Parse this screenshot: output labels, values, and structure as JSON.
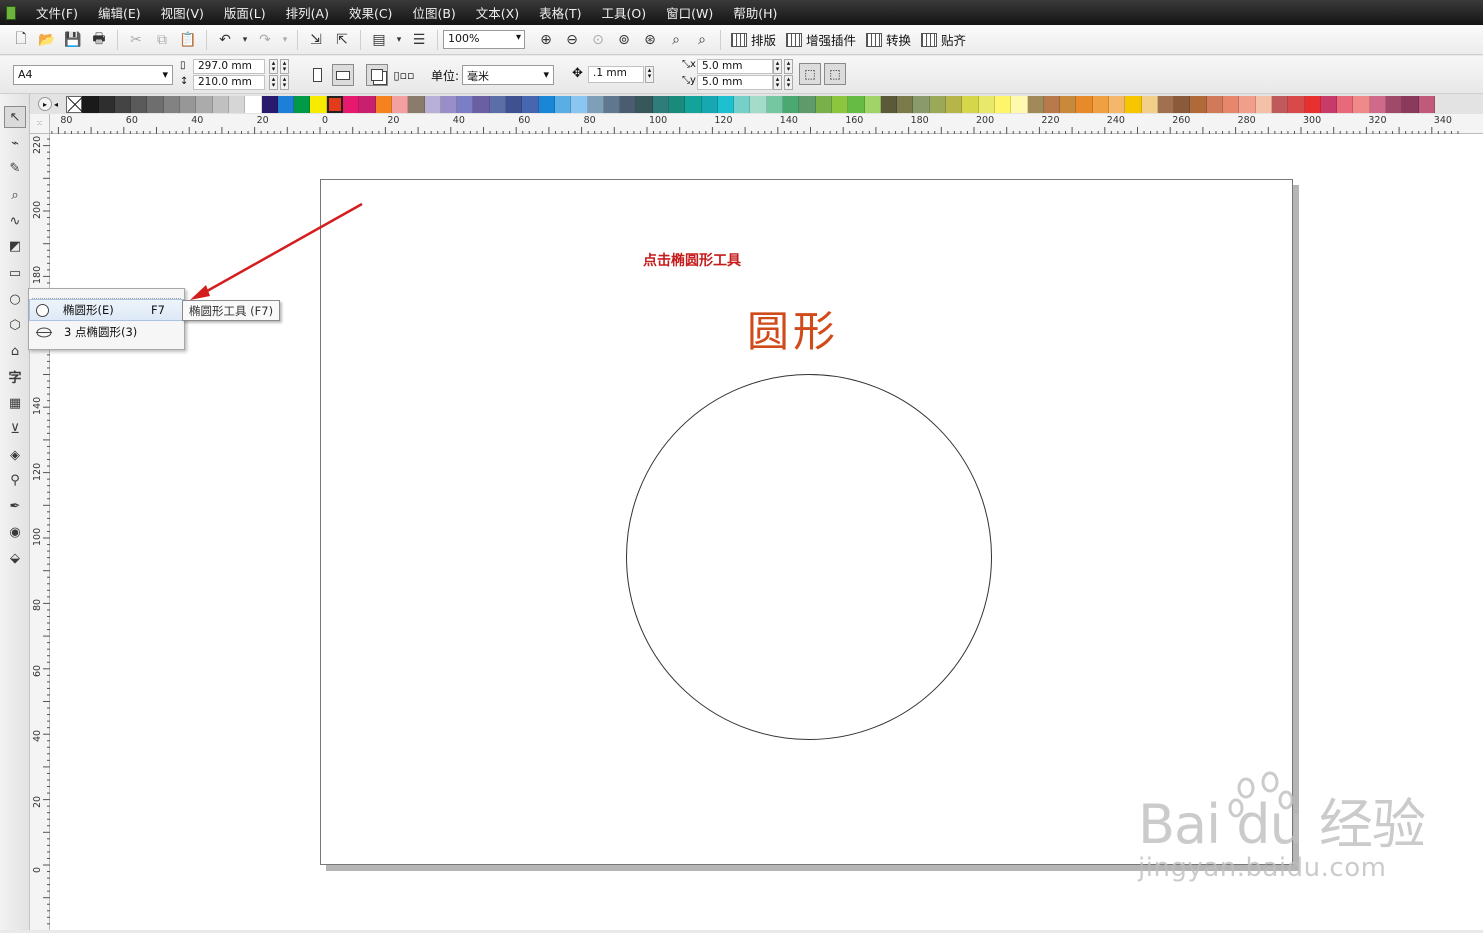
{
  "menubar": {
    "items": [
      "文件(F)",
      "编辑(E)",
      "视图(V)",
      "版面(L)",
      "排列(A)",
      "效果(C)",
      "位图(B)",
      "文本(X)",
      "表格(T)",
      "工具(O)",
      "窗口(W)",
      "帮助(H)"
    ]
  },
  "toolbar": {
    "zoom": "100%",
    "buttons": [
      "排版",
      "增强插件",
      "转换",
      "贴齐"
    ]
  },
  "property_bar": {
    "page_size": "A4",
    "width": "297.0 mm",
    "height": "210.0 mm",
    "unit_label": "单位:",
    "unit_value": "毫米",
    "nudge": ".1 mm",
    "dup_x": "5.0 mm",
    "dup_y": "5.0 mm"
  },
  "palette": {
    "colors": [
      "#1a1a1a",
      "#2e2e2e",
      "#444444",
      "#5a5a5a",
      "#6e6e6e",
      "#828282",
      "#979797",
      "#ababab",
      "#c0c0c0",
      "#d6d6d6",
      "#ffffff",
      "#2a1a6e",
      "#1e7fd6",
      "#009a46",
      "#f7ec00",
      "#e23c1c",
      "#e6196e",
      "#c81f6f",
      "#f5821f",
      "#f2a0a0",
      "#8a7b6b",
      "#b8b0d6",
      "#9a8ec9",
      "#7b7ec4",
      "#6a5fa3",
      "#5b6ea8",
      "#3f5190",
      "#4666b0",
      "#1a87d6",
      "#5aaee6",
      "#8ac6ef",
      "#7f9fb8",
      "#5f7890",
      "#4a5c70",
      "#37585a",
      "#2f7d7a",
      "#1a8a7a",
      "#14a39b",
      "#17a7b3",
      "#1ec0cf",
      "#75d1c8",
      "#a4dcc9",
      "#74c7a0",
      "#4aa870",
      "#5e9a6a",
      "#7ab04a",
      "#8cc63f",
      "#66bb44",
      "#a0d468",
      "#5a5a3a",
      "#7a7a4a",
      "#8a9a6a",
      "#9aa858",
      "#b5b54a",
      "#d6d64a",
      "#e8e86a",
      "#fff56a",
      "#fff9b0",
      "#a08a5a",
      "#b87a4a",
      "#c88a3a",
      "#e68a2a",
      "#f0a040",
      "#f5b86a",
      "#f7c600",
      "#f2d08a",
      "#a07050",
      "#8a5a3a",
      "#b06a3a",
      "#d07a5a",
      "#e6866a",
      "#f0a08a",
      "#f5c0a8",
      "#c05a5a",
      "#d84a4a",
      "#e83030",
      "#c83a6a",
      "#e86a7a",
      "#f08a8a",
      "#d06a8a",
      "#a04a6a",
      "#8a3a5a",
      "#c05a7a"
    ],
    "selected_index": 15
  },
  "rulers": {
    "h_labels": [
      "80",
      "60",
      "40",
      "20",
      "0",
      "20",
      "40",
      "60",
      "80",
      "100",
      "120",
      "140",
      "160",
      "180",
      "200",
      "220",
      "240",
      "260",
      "280",
      "300",
      "320",
      "340"
    ],
    "v_labels": [
      "220",
      "200",
      "180",
      "160",
      "140",
      "120",
      "100",
      "80",
      "60",
      "40",
      "20",
      "0"
    ],
    "unit": "毫米"
  },
  "toolbox": {
    "tools": [
      "pick",
      "shape",
      "smear",
      "zoom",
      "freehand",
      "smart-fill",
      "rectangle",
      "ellipse",
      "polygon",
      "basic-shapes",
      "text",
      "table",
      "dimension",
      "interactive-fill",
      "eyedropper",
      "outline",
      "fill",
      "interactive"
    ]
  },
  "flyout": {
    "items": [
      {
        "label": "椭圆形(E)",
        "shortcut": "F7"
      },
      {
        "label": "3 点椭圆形(3)",
        "shortcut": ""
      }
    ],
    "tooltip": "椭圆形工具 (F7)"
  },
  "document": {
    "title_text": "圆形",
    "annotation": "点击椭圆形工具",
    "colors": {
      "title": "#d04a1a",
      "annotation": "#c51d1d"
    }
  },
  "watermark": {
    "main": "Bai du 经验",
    "sub": "jingyan.baidu.com"
  }
}
